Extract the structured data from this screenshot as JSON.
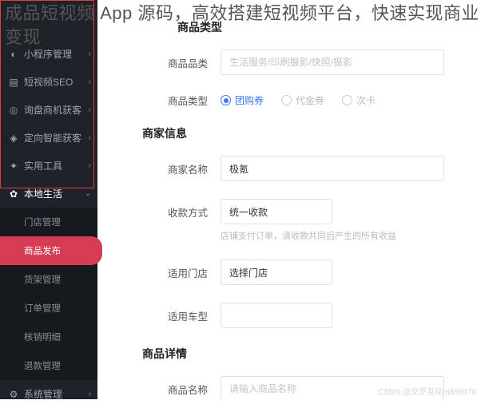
{
  "overlay_title": "成品短视频 App 源码，高效搭建短视频平台，快速实现商业变现",
  "sidebar": {
    "items": [
      {
        "label": "小程序管理",
        "icon": "miniapp-icon"
      },
      {
        "label": "短视频SEO",
        "icon": "video-icon"
      },
      {
        "label": "询盘商机获客",
        "icon": "inquiry-icon"
      },
      {
        "label": "定向智能获客",
        "icon": "target-icon"
      },
      {
        "label": "实用工具",
        "icon": "tools-icon"
      },
      {
        "label": "本地生活",
        "icon": "local-icon"
      }
    ],
    "sub": [
      {
        "label": "门店管理"
      },
      {
        "label": "商品发布"
      },
      {
        "label": "货架管理"
      },
      {
        "label": "订单管理"
      },
      {
        "label": "核销明细"
      },
      {
        "label": "退款管理"
      }
    ],
    "bottom": {
      "label": "系统管理",
      "icon": "settings-icon"
    }
  },
  "main": {
    "section1_title": "商品类型",
    "category": {
      "label": "商品品类",
      "placeholder": "生活服务/印刷摄影/快照/摄影"
    },
    "product_type": {
      "label": "商品类型",
      "options": [
        {
          "text": "团购券",
          "selected": true
        },
        {
          "text": "代金券",
          "selected": false
        },
        {
          "text": "次卡",
          "selected": false
        }
      ]
    },
    "section2_title": "商家信息",
    "merchant": {
      "label": "商家名称",
      "value": "极氪"
    },
    "collection": {
      "label": "收款方式",
      "value": "统一收款",
      "hint": "店铺支付订单，请收款共同后产生的所有收益"
    },
    "store": {
      "label": "适用门店",
      "value": "选择门店"
    },
    "car_type": {
      "label": "适用车型"
    },
    "section3_title": "商品详情",
    "product_name": {
      "label": "商品名称",
      "placeholder": "请输入商品名称"
    }
  },
  "watermark": "CSDN @交罗互动m898970"
}
